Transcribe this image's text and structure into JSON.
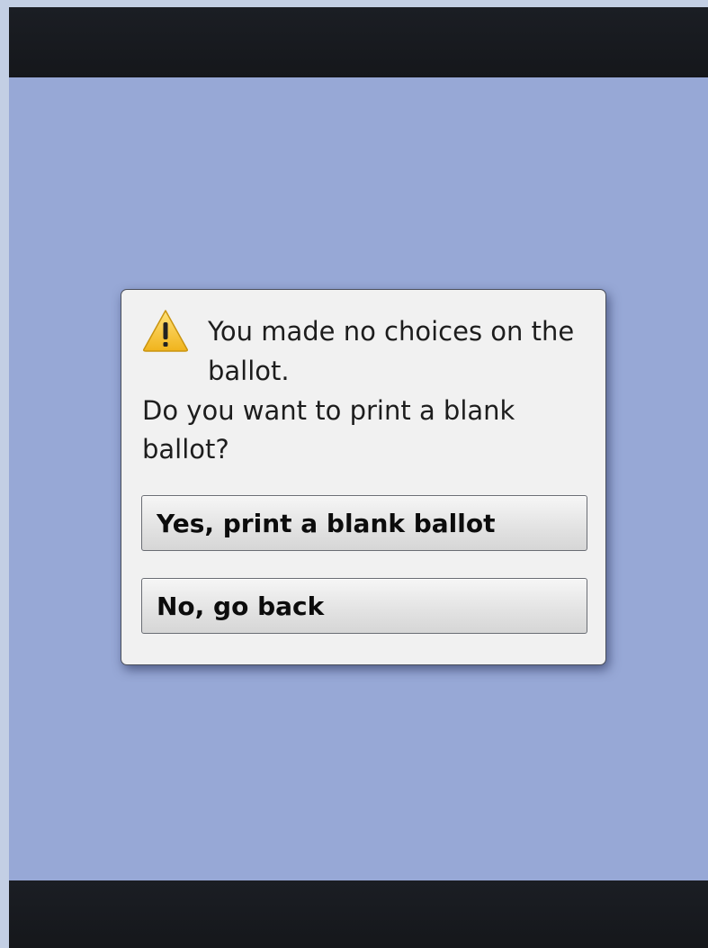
{
  "dialog": {
    "message_line_1": "You made no choices on the",
    "message_line_2": "ballot.",
    "question_line_1": "Do you want to print a blank",
    "question_line_2": "ballot?",
    "icon": "warning-icon",
    "yes_button_label": "Yes, print a blank ballot",
    "no_button_label": "No, go back"
  },
  "colors": {
    "background": "#97a8d6",
    "bars": "#1a1d22",
    "dialog": "#f1f1f1",
    "warning_fill": "#f5c426"
  }
}
